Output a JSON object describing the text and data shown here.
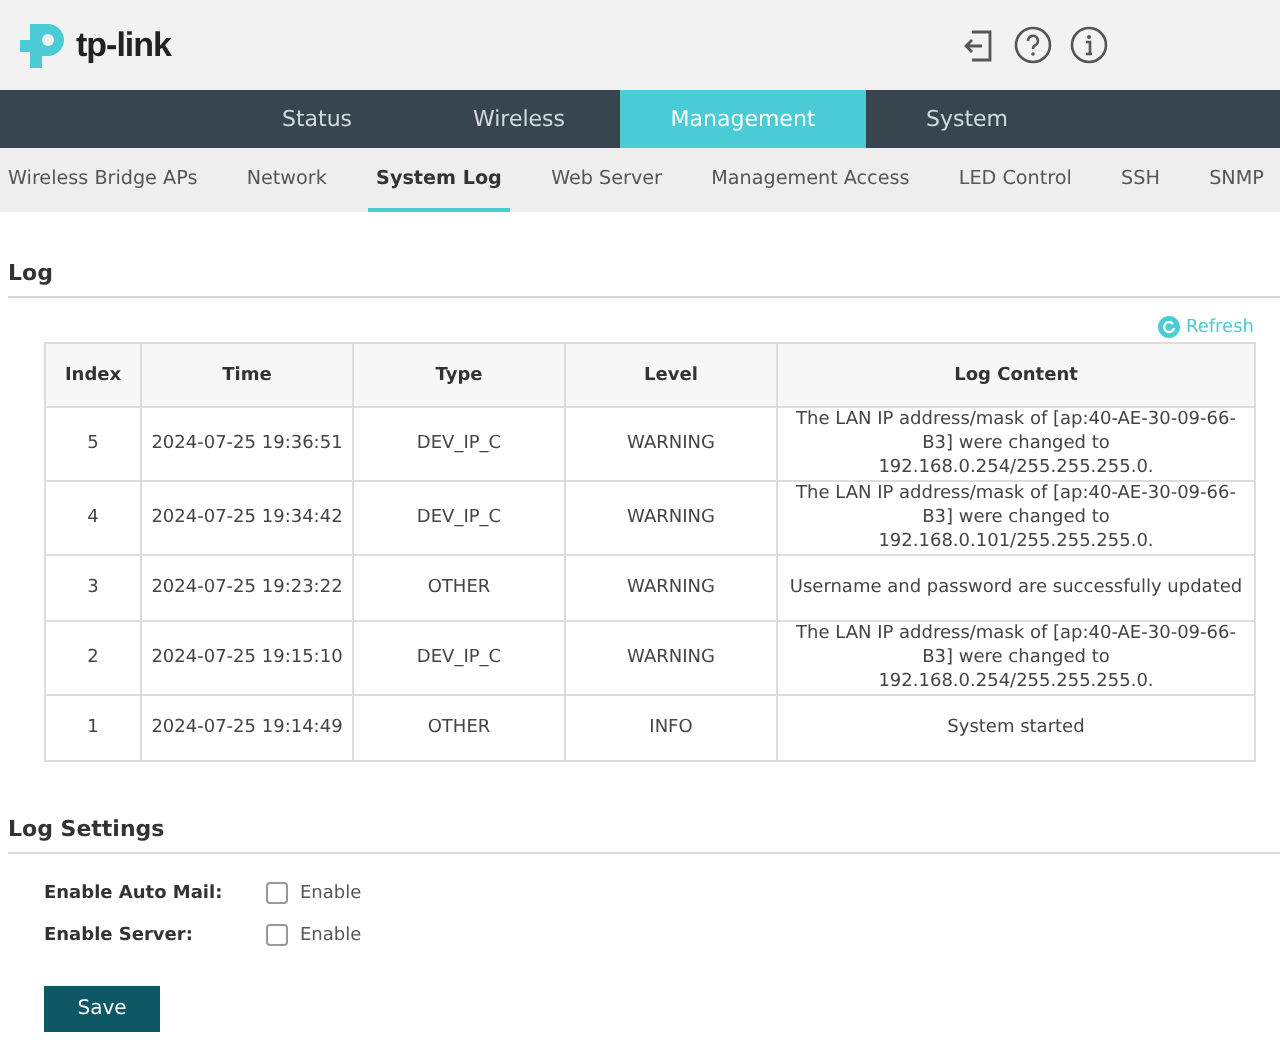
{
  "header": {
    "logo": "tp-link"
  },
  "main_tabs": [
    {
      "label": "Status",
      "selected": false
    },
    {
      "label": "Wireless",
      "selected": false
    },
    {
      "label": "Management",
      "selected": true
    },
    {
      "label": "System",
      "selected": false
    }
  ],
  "sub_tabs": [
    {
      "label": "Wireless Bridge APs",
      "selected": false
    },
    {
      "label": "Network",
      "selected": false
    },
    {
      "label": "System Log",
      "selected": true
    },
    {
      "label": "Web Server",
      "selected": false
    },
    {
      "label": "Management Access",
      "selected": false
    },
    {
      "label": "LED Control",
      "selected": false
    },
    {
      "label": "SSH",
      "selected": false
    },
    {
      "label": "SNMP",
      "selected": false
    }
  ],
  "log": {
    "title": "Log",
    "refresh": "Refresh",
    "columns": [
      "Index",
      "Time",
      "Type",
      "Level",
      "Log Content"
    ],
    "rows": [
      {
        "index": "5",
        "time": "2024-07-25 19:36:51",
        "type": "DEV_IP_C",
        "level": "WARNING",
        "content": "The LAN IP address/mask of [ap:40-AE-30-09-66-B3] were changed to 192.168.0.254/255.255.255.0."
      },
      {
        "index": "4",
        "time": "2024-07-25 19:34:42",
        "type": "DEV_IP_C",
        "level": "WARNING",
        "content": "The LAN IP address/mask of [ap:40-AE-30-09-66-B3] were changed to 192.168.0.101/255.255.255.0."
      },
      {
        "index": "3",
        "time": "2024-07-25 19:23:22",
        "type": "OTHER",
        "level": "WARNING",
        "content": "Username and password are successfully updated"
      },
      {
        "index": "2",
        "time": "2024-07-25 19:15:10",
        "type": "DEV_IP_C",
        "level": "WARNING",
        "content": "The LAN IP address/mask of [ap:40-AE-30-09-66-B3] were changed to 192.168.0.254/255.255.255.0."
      },
      {
        "index": "1",
        "time": "2024-07-25 19:14:49",
        "type": "OTHER",
        "level": "INFO",
        "content": "System started"
      }
    ]
  },
  "log_settings": {
    "title": "Log Settings",
    "options": [
      {
        "label": "Enable Auto Mail:",
        "option": "Enable",
        "checked": false
      },
      {
        "label": "Enable Server:",
        "option": "Enable",
        "checked": false
      }
    ],
    "save": "Save"
  }
}
